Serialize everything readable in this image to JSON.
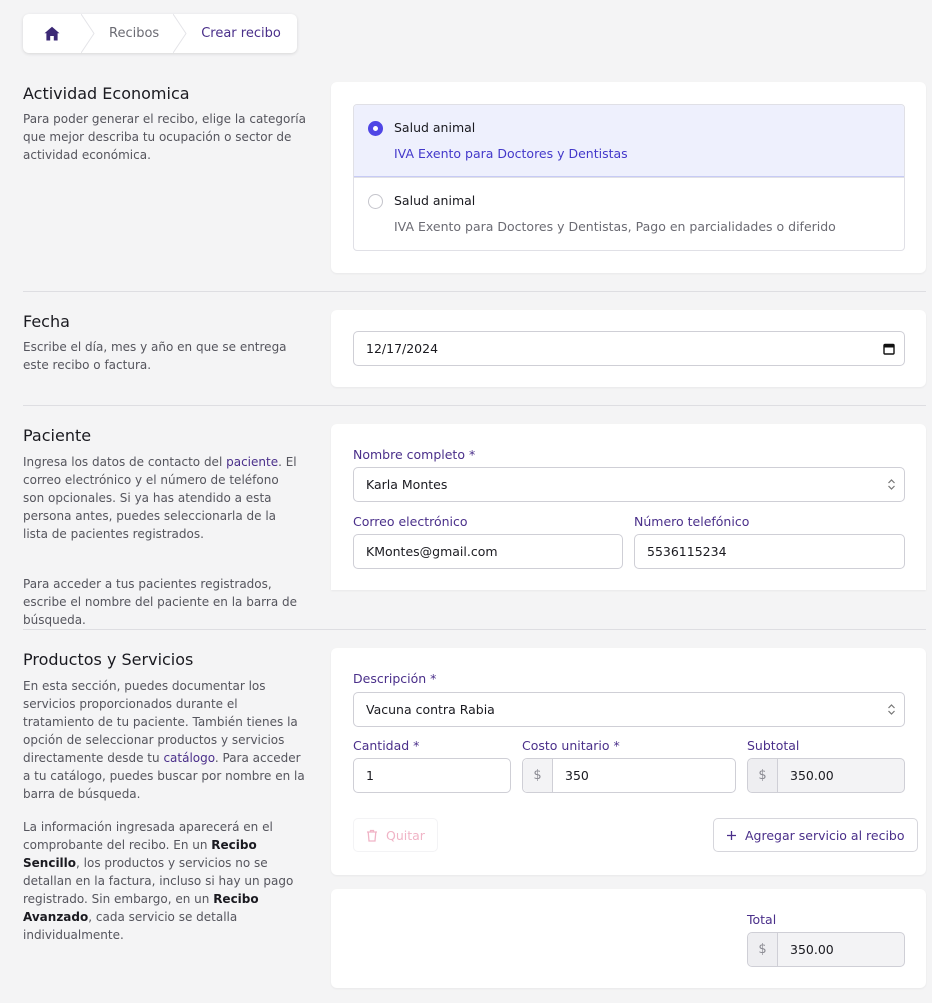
{
  "breadcrumb": {
    "home_icon": "home-icon",
    "items": [
      "Recibos",
      "Crear recibo"
    ]
  },
  "actividad": {
    "title": "Actividad Economica",
    "desc": "Para poder generar el recibo, elige la categoría que mejor describa tu ocupación o sector de actividad económica.",
    "options": [
      {
        "title": "Salud animal",
        "subtitle": "IVA Exento para Doctores y Dentistas",
        "selected": true
      },
      {
        "title": "Salud animal",
        "subtitle": "IVA Exento para Doctores y Dentistas, Pago en parcialidades o diferido",
        "selected": false
      }
    ]
  },
  "fecha": {
    "title": "Fecha",
    "desc": "Escribe el día, mes y año en que se entrega este recibo o factura.",
    "value": "12/17/2024"
  },
  "paciente": {
    "title": "Paciente",
    "desc_pre": "Ingresa los datos de contacto del ",
    "desc_link": "paciente",
    "desc_post": ". El correo electrónico y el número de teléfono son opcionales. Si ya has atendido a esta persona antes, puedes seleccionarla de la lista de pacientes registrados.",
    "desc2": "Para acceder a tus pacientes registrados, escribe el nombre del paciente en la barra de búsqueda.",
    "name_label": "Nombre completo *",
    "name_value": "Karla Montes",
    "email_label": "Correo electrónico",
    "email_value": "KMontes@gmail.com",
    "phone_label": "Número telefónico",
    "phone_value": "5536115234"
  },
  "productos": {
    "title": "Productos y Servicios",
    "desc_pre": "En esta sección, puedes documentar los servicios proporcionados durante el tratamiento de tu paciente. También tienes la opción de seleccionar productos y servicios directamente desde tu ",
    "desc_link": "catálogo",
    "desc_post": ". Para acceder a tu catálogo, puedes buscar por nombre en la barra de búsqueda.",
    "desc2_a": "La información ingresada aparecerá en el comprobante del recibo. En un ",
    "desc2_b": "Recibo Sencillo",
    "desc2_c": ", los productos y servicios no se detallan en la factura, incluso si hay un pago registrado. Sin embargo, en un ",
    "desc2_d": "Recibo Avanzado",
    "desc2_e": ", cada servicio se detalla individualmente.",
    "desc_label": "Descripción *",
    "desc_value": "Vacuna contra Rabia",
    "qty_label": "Cantidad *",
    "qty_value": "1",
    "cost_label": "Costo unitario *",
    "cost_value": "350",
    "subtotal_label": "Subtotal",
    "subtotal_value": "350.00",
    "currency": "$",
    "remove_label": "Quitar",
    "add_label": "Agregar servicio al recibo",
    "total_label": "Total",
    "total_value": "350.00"
  },
  "colors": {
    "accent": "#4f46e5",
    "brand": "#4a2f8a",
    "selected_bg": "#eef0fd"
  }
}
